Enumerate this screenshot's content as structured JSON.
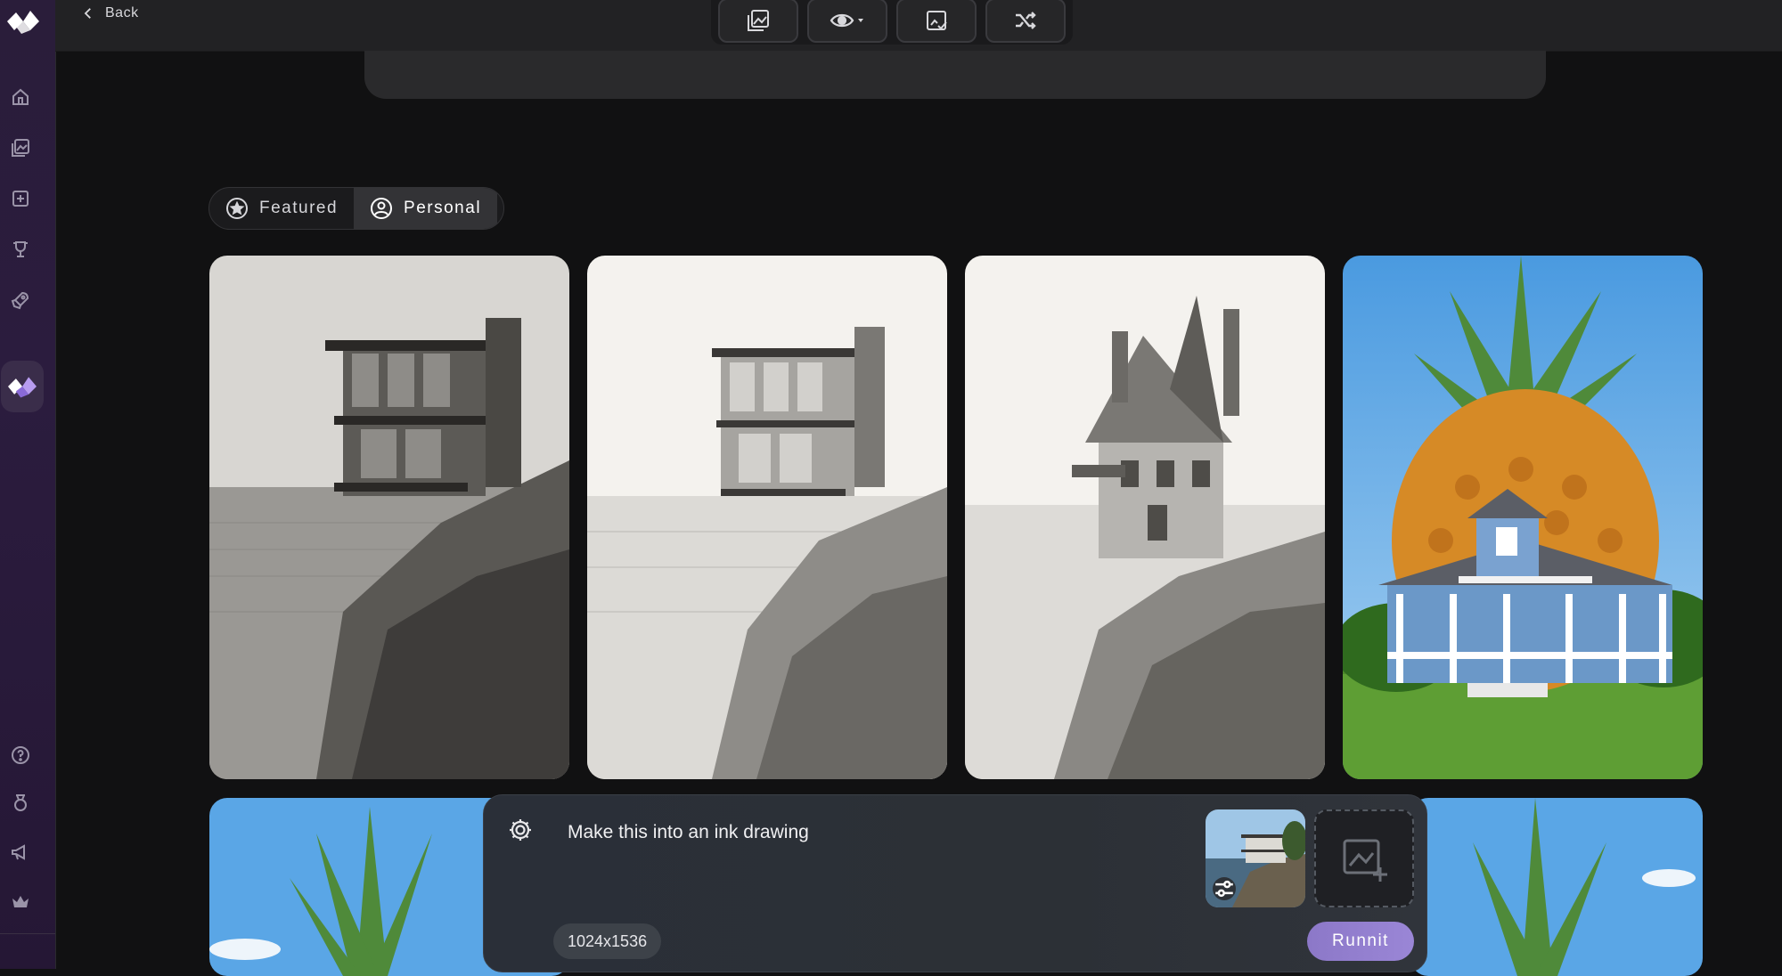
{
  "topbar": {
    "back_label": "Back"
  },
  "tabs": [
    {
      "label": "Featured",
      "active": false
    },
    {
      "label": "Personal",
      "active": true
    }
  ],
  "prompt": {
    "text": "Make this into an ink drawing",
    "size": "1024x1536",
    "run_label": "Runnit"
  },
  "colors": {
    "accent": "#9a86d6",
    "sidebar": "#2a1d3a",
    "background": "#111112"
  }
}
